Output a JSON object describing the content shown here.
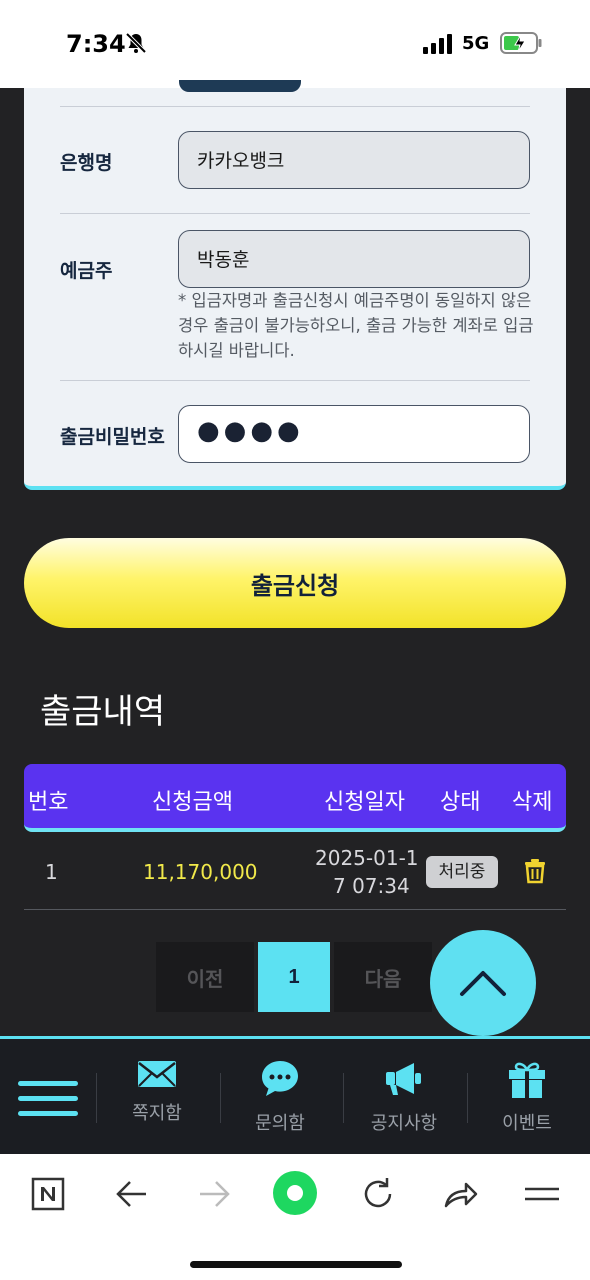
{
  "status_bar": {
    "time": "7:34",
    "network": "5G",
    "icons": [
      "bell-mute-icon",
      "signal-icon",
      "battery-charging-icon"
    ]
  },
  "form": {
    "bank_label": "은행명",
    "bank_value": "카카오뱅크",
    "holder_label": "예금주",
    "holder_value": "박동훈",
    "holder_notice": "* 입금자명과 출금신청시 예금주명이 동일하지 않은경우 출금이 불가능하오니, 출금 가능한 계좌로 입금하시길 바랍니다.",
    "password_label": "출금비밀번호",
    "password_value": "●●●●"
  },
  "withdraw_button": "출금신청",
  "history": {
    "title": "출금내역",
    "columns": [
      "번호",
      "신청금액",
      "신청일자",
      "상태",
      "삭제"
    ],
    "rows": [
      {
        "no": "1",
        "amount": "11,170,000",
        "date_line1": "2025-01-1",
        "date_line2": "7 07:34",
        "status": "처리중",
        "delete_icon": "trash-icon"
      }
    ]
  },
  "pagination": {
    "prev": "이전",
    "current": "1",
    "next": "다음"
  },
  "bottom_nav": {
    "items": [
      {
        "label": "쪽지함",
        "icon": "envelope-icon"
      },
      {
        "label": "문의함",
        "icon": "chat-bubble-icon"
      },
      {
        "label": "공지사항",
        "icon": "megaphone-icon"
      },
      {
        "label": "이벤트",
        "icon": "gift-icon"
      }
    ]
  },
  "browser_toolbar": {
    "icons": [
      "naver-n-icon",
      "back-arrow-icon",
      "forward-arrow-icon",
      "green-home-icon",
      "reload-icon",
      "share-icon",
      "menu-icon"
    ]
  },
  "colors": {
    "accent_cyan": "#5ce1f2",
    "table_header_purple": "#5a33f0",
    "button_yellow": "#fff46a",
    "amount_yellow": "#f1e94a"
  }
}
